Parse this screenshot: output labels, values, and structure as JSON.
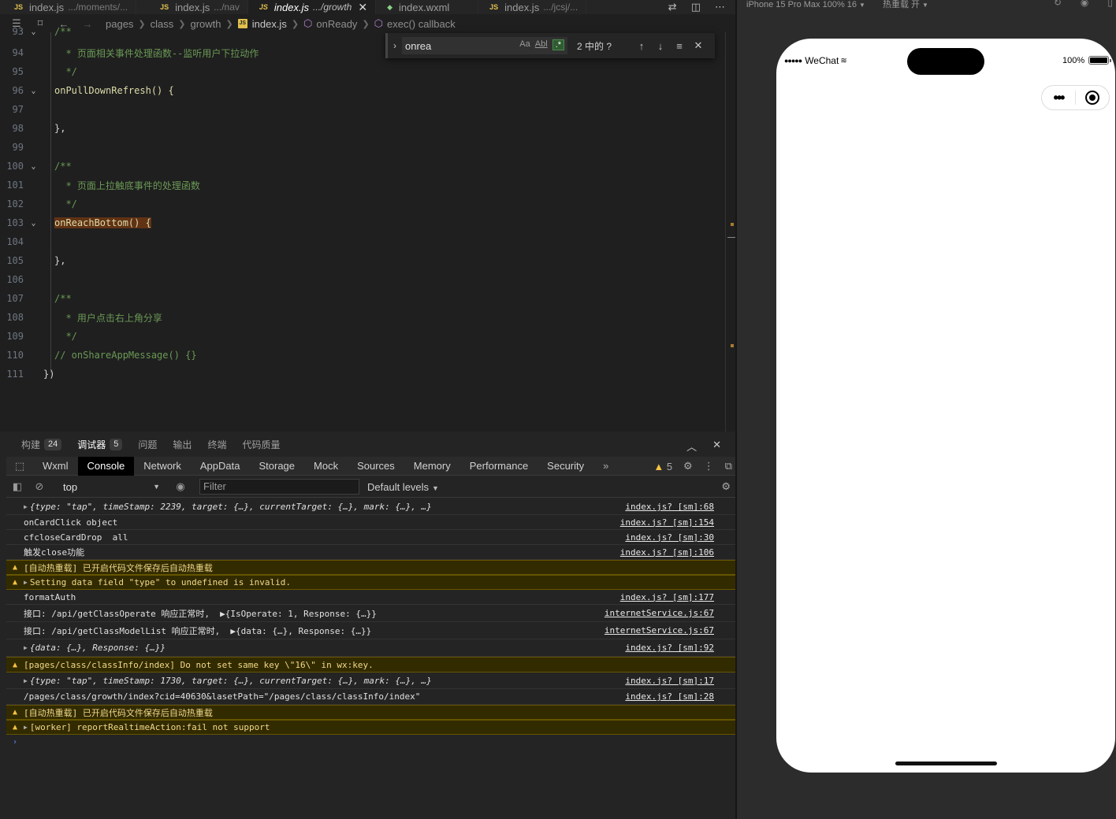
{
  "tabs": [
    {
      "name": "index.js",
      "path": ".../moments/...",
      "icon": "JS",
      "active": false
    },
    {
      "name": "index.js",
      "path": ".../nav",
      "icon": "JS",
      "active": false
    },
    {
      "name": "index.js",
      "path": ".../growth",
      "icon": "JS",
      "active": true
    },
    {
      "name": "index.wxml",
      "path": "",
      "icon": "wxml",
      "active": false
    },
    {
      "name": "index.js",
      "path": ".../jcsj/...",
      "icon": "JS",
      "active": false
    }
  ],
  "breadcrumb": {
    "items": [
      "pages",
      "class",
      "growth"
    ],
    "file": "index.js",
    "symbol": "onReady",
    "callback": "exec() callback"
  },
  "find": {
    "query": "onrea",
    "opt_case": "Aa",
    "opt_word": "Abl",
    "opt_regex": ".*",
    "count": "2 中的 ?"
  },
  "code": {
    "lines": [
      {
        "n": "94",
        "text": "  * 页面相关事件处理函数--监听用户下拉动作"
      },
      {
        "n": "95",
        "text": "  */"
      },
      {
        "n": "96",
        "text": "onPullDownRefresh() {"
      },
      {
        "n": "97",
        "text": ""
      },
      {
        "n": "98",
        "text": "},"
      },
      {
        "n": "99",
        "text": ""
      },
      {
        "n": "100",
        "text": "/**"
      },
      {
        "n": "101",
        "text": "  * 页面上拉触底事件的处理函数"
      },
      {
        "n": "102",
        "text": "  */"
      },
      {
        "n": "103",
        "text": "onReachBottom() {"
      },
      {
        "n": "104",
        "text": ""
      },
      {
        "n": "105",
        "text": "},"
      },
      {
        "n": "106",
        "text": ""
      },
      {
        "n": "107",
        "text": "/**"
      },
      {
        "n": "108",
        "text": "  * 用户点击右上角分享"
      },
      {
        "n": "109",
        "text": "  */"
      },
      {
        "n": "110",
        "text": "// onShareAppMessage() {}"
      },
      {
        "n": "111",
        "text": "})"
      }
    ],
    "top_partial": "/**"
  },
  "panel": {
    "tabs": [
      {
        "label": "构建",
        "badge": "24"
      },
      {
        "label": "调试器",
        "badge": "5"
      },
      {
        "label": "问题",
        "badge": ""
      },
      {
        "label": "输出",
        "badge": ""
      },
      {
        "label": "终端",
        "badge": ""
      },
      {
        "label": "代码质量",
        "badge": ""
      }
    ],
    "devtools_tabs": [
      "Wxml",
      "Console",
      "Network",
      "AppData",
      "Storage",
      "Mock",
      "Sources",
      "Memory",
      "Performance",
      "Security"
    ],
    "more": "»",
    "warning_count": "5",
    "context": "top",
    "filter_placeholder": "Filter",
    "levels": "Default levels"
  },
  "console": [
    {
      "type": "log",
      "expand": true,
      "msg": "{type: \"tap\", timeStamp: 2239, target: {…}, currentTarget: {…}, mark: {…}, …}",
      "src": "index.js? [sm]:68"
    },
    {
      "type": "log",
      "expand": false,
      "msg": "onCardClick object",
      "src": "index.js? [sm]:154"
    },
    {
      "type": "log",
      "expand": false,
      "msg": "cfcloseCardDrop  all",
      "src": "index.js? [sm]:30"
    },
    {
      "type": "log",
      "expand": false,
      "msg": "触发close功能",
      "src": "index.js? [sm]:106"
    },
    {
      "type": "warn",
      "expand": false,
      "msg": "[自动热重载] 已开启代码文件保存后自动热重载",
      "src": ""
    },
    {
      "type": "warn",
      "expand": true,
      "msg": "Setting data field \"type\" to undefined is invalid.",
      "src": ""
    },
    {
      "type": "log",
      "expand": false,
      "msg": "formatAuth",
      "src": "index.js? [sm]:177"
    },
    {
      "type": "log",
      "expand": false,
      "msg": "接口: /api/getClassOperate 响应正常时,  ▶{IsOperate: 1, Response: {…}}",
      "src": "internetService.js:67"
    },
    {
      "type": "log",
      "expand": false,
      "msg": "接口: /api/getClassModelList 响应正常时,  ▶{data: {…}, Response: {…}}",
      "src": "internetService.js:67"
    },
    {
      "type": "log",
      "expand": true,
      "msg": "{data: {…}, Response: {…}}",
      "src": "index.js? [sm]:92"
    },
    {
      "type": "warn",
      "expand": false,
      "msg": "[pages/class/classInfo/index] Do not set same key \\\"16\\\" in wx:key.",
      "src": ""
    },
    {
      "type": "log",
      "expand": true,
      "msg": "{type: \"tap\", timeStamp: 1730, target: {…}, currentTarget: {…}, mark: {…}, …}",
      "src": "index.js? [sm]:17"
    },
    {
      "type": "log",
      "expand": false,
      "msg": "/pages/class/growth/index?cid=40630&lasetPath=\"/pages/class/classInfo/index\"",
      "src": "index.js? [sm]:28"
    },
    {
      "type": "warn",
      "expand": false,
      "msg": "[自动热重载] 已开启代码文件保存后自动热重载",
      "src": ""
    },
    {
      "type": "warn",
      "expand": true,
      "msg": "[worker] reportRealtimeAction:fail not support",
      "src": ""
    }
  ],
  "simulator": {
    "device": "iPhone 15 Pro Max 100% 16",
    "hotreload": "热重载 开",
    "carrier": "WeChat",
    "battery": "100%"
  },
  "colors": {
    "accent_tab_active": "#ffffff",
    "warning": "#f5c242",
    "comment": "#6a9955",
    "function": "#dcdcaa"
  }
}
